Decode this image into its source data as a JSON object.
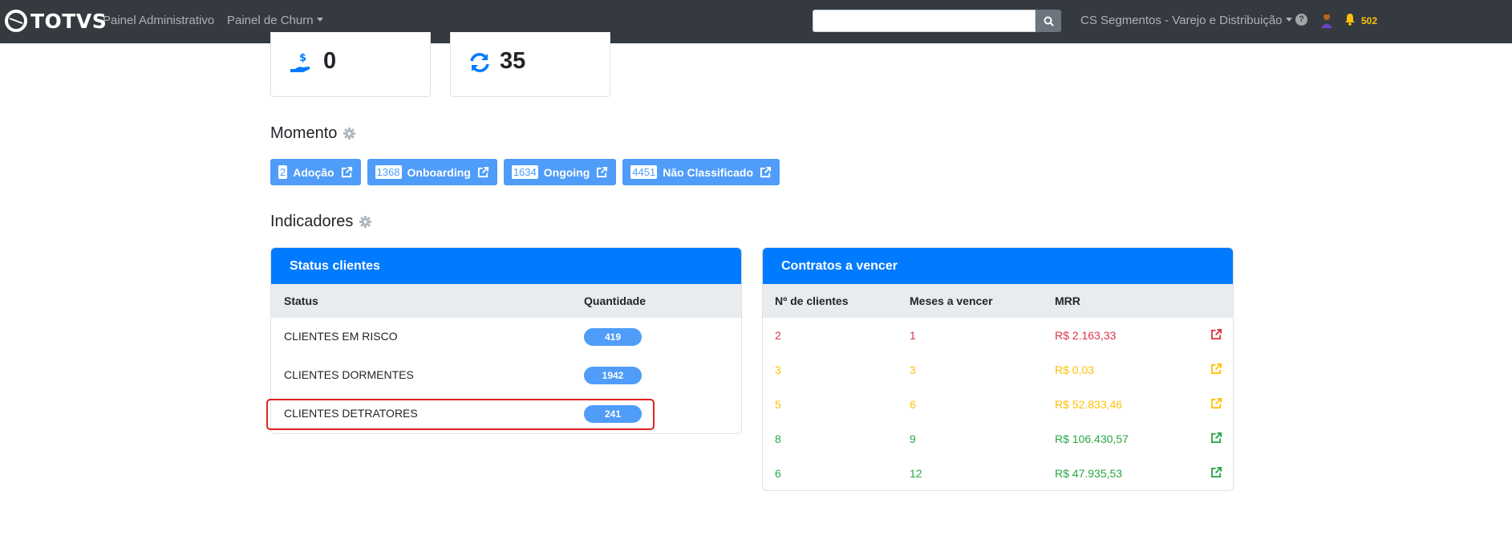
{
  "navbar": {
    "brand": "TOTVS",
    "links": [
      "Painel Administrativo",
      "Painel de Churn"
    ],
    "search_placeholder": "",
    "segment": "CS Segmentos - Varejo e Distribuição",
    "notifications": "502",
    "colors": {
      "background": "#343a40",
      "notification": "#ffc107"
    }
  },
  "top_cards": [
    {
      "icon": "hand-money-icon",
      "value": "0"
    },
    {
      "icon": "sync-icon",
      "value": "35"
    }
  ],
  "momento": {
    "title": "Momento",
    "pills": [
      {
        "count": "2",
        "label": "Adoção"
      },
      {
        "count": "1368",
        "label": "Onboarding"
      },
      {
        "count": "1634",
        "label": "Ongoing"
      },
      {
        "count": "4451",
        "label": "Não Classificado"
      }
    ]
  },
  "indicadores": {
    "title": "Indicadores"
  },
  "status_clientes": {
    "title": "Status clientes",
    "columns": [
      "Status",
      "Quantidade"
    ],
    "rows": [
      {
        "status": "CLIENTES EM RISCO",
        "qty": "419"
      },
      {
        "status": "CLIENTES DORMENTES",
        "qty": "1942"
      },
      {
        "status": "CLIENTES DETRATORES",
        "qty": "241"
      }
    ]
  },
  "contratos": {
    "title": "Contratos a vencer",
    "columns": [
      "Nº de clientes",
      "Meses a vencer",
      "MRR"
    ],
    "rows": [
      {
        "clientes": "2",
        "meses": "1",
        "mrr": "R$ 2.163,33",
        "color": "#dc3545"
      },
      {
        "clientes": "3",
        "meses": "3",
        "mrr": "R$ 0,03",
        "color": "#ffc107"
      },
      {
        "clientes": "5",
        "meses": "6",
        "mrr": "R$ 52.833,46",
        "color": "#ffc107"
      },
      {
        "clientes": "8",
        "meses": "9",
        "mrr": "R$ 106.430,57",
        "color": "#28a745"
      },
      {
        "clientes": "6",
        "meses": "12",
        "mrr": "R$ 47.935,53",
        "color": "#28a745"
      }
    ]
  },
  "colors": {
    "primary": "#007bff",
    "pill": "#4f9cf9"
  }
}
